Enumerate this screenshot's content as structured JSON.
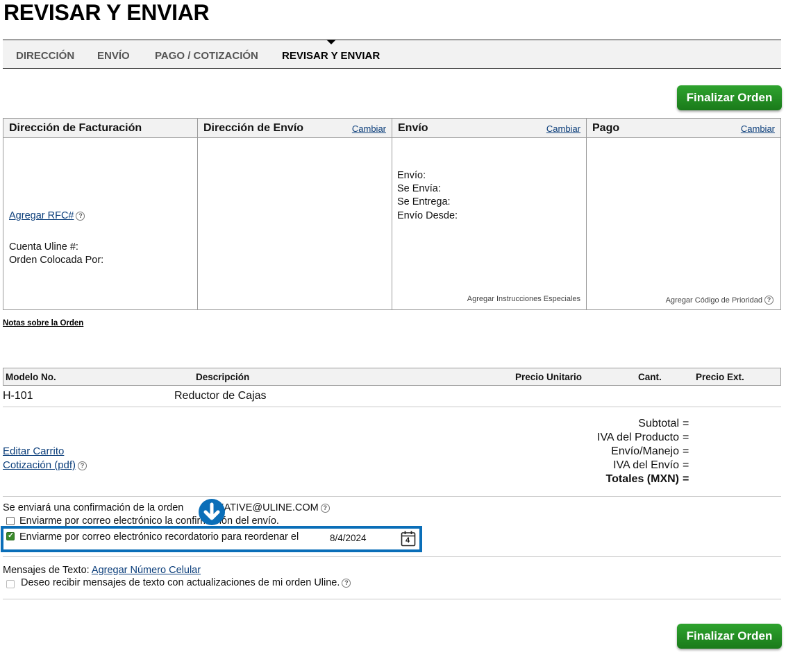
{
  "page": {
    "title": "REVISAR Y ENVIAR"
  },
  "steps": [
    {
      "label": "DIRECCIÓN"
    },
    {
      "label": "ENVÍO"
    },
    {
      "label": "PAGO / COTIZACIÓN"
    },
    {
      "label": "REVISAR Y ENVIAR"
    }
  ],
  "actions": {
    "finalize_label": "Finalizar Orden"
  },
  "panels": {
    "billing": {
      "title": "Dirección de Facturación",
      "add_rfc": "Agregar RFC#",
      "help": "?",
      "account_label": "Cuenta Uline #:",
      "placed_by_label": "Orden Colocada Por:"
    },
    "shipping_address": {
      "title": "Dirección de Envío",
      "change": "Cambiar"
    },
    "shipping": {
      "title": "Envío",
      "change": "Cambiar",
      "lines": [
        "Envío:",
        "Se Envía:",
        "Se Entrega:",
        "Envío Desde:"
      ],
      "special_instructions": "Agregar Instrucciones Especiales"
    },
    "payment": {
      "title": "Pago",
      "change": "Cambiar",
      "priority_code": "Agregar Código de Prioridad",
      "help": "?"
    }
  },
  "order_notes": "Notas sobre la Orden",
  "table": {
    "headers": [
      "Modelo No.",
      "Descripción",
      "Precio Unitario",
      "Cant.",
      "Precio Ext."
    ],
    "rows": [
      {
        "model": "H-101",
        "description": "Reductor de Cajas"
      }
    ]
  },
  "cart": {
    "edit": "Editar Carrito",
    "quote": "Cotización (pdf)",
    "help": "?"
  },
  "totals": {
    "labels": [
      "Subtotal",
      "IVA del Producto",
      "Envío/Manejo",
      "IVA del Envío",
      "Totales (MXN)"
    ],
    "eq": "="
  },
  "confirmation": {
    "text_before": "Se enviará una confirmación de la orden",
    "email": "REATIVE@ULINE.COM",
    "help": "?",
    "ship_confirm": "Enviarme por correo electrónico la confirmación del envío.",
    "reorder_reminder": "Enviarme por correo electrónico recordatorio para reordenar el",
    "reorder_date": "8/4/2024",
    "calendar_day": "4"
  },
  "sms": {
    "label": "Mensajes de Texto:",
    "add_number": "Agregar Número Celular",
    "opt_in": "Deseo recibir mensajes de texto con actualizaciones de mi orden Uline.",
    "help": "?"
  },
  "colors": {
    "accent_green": "#1f8a1f",
    "highlight_blue": "#0a6eb8",
    "link_blue": "#0a3d7a"
  }
}
